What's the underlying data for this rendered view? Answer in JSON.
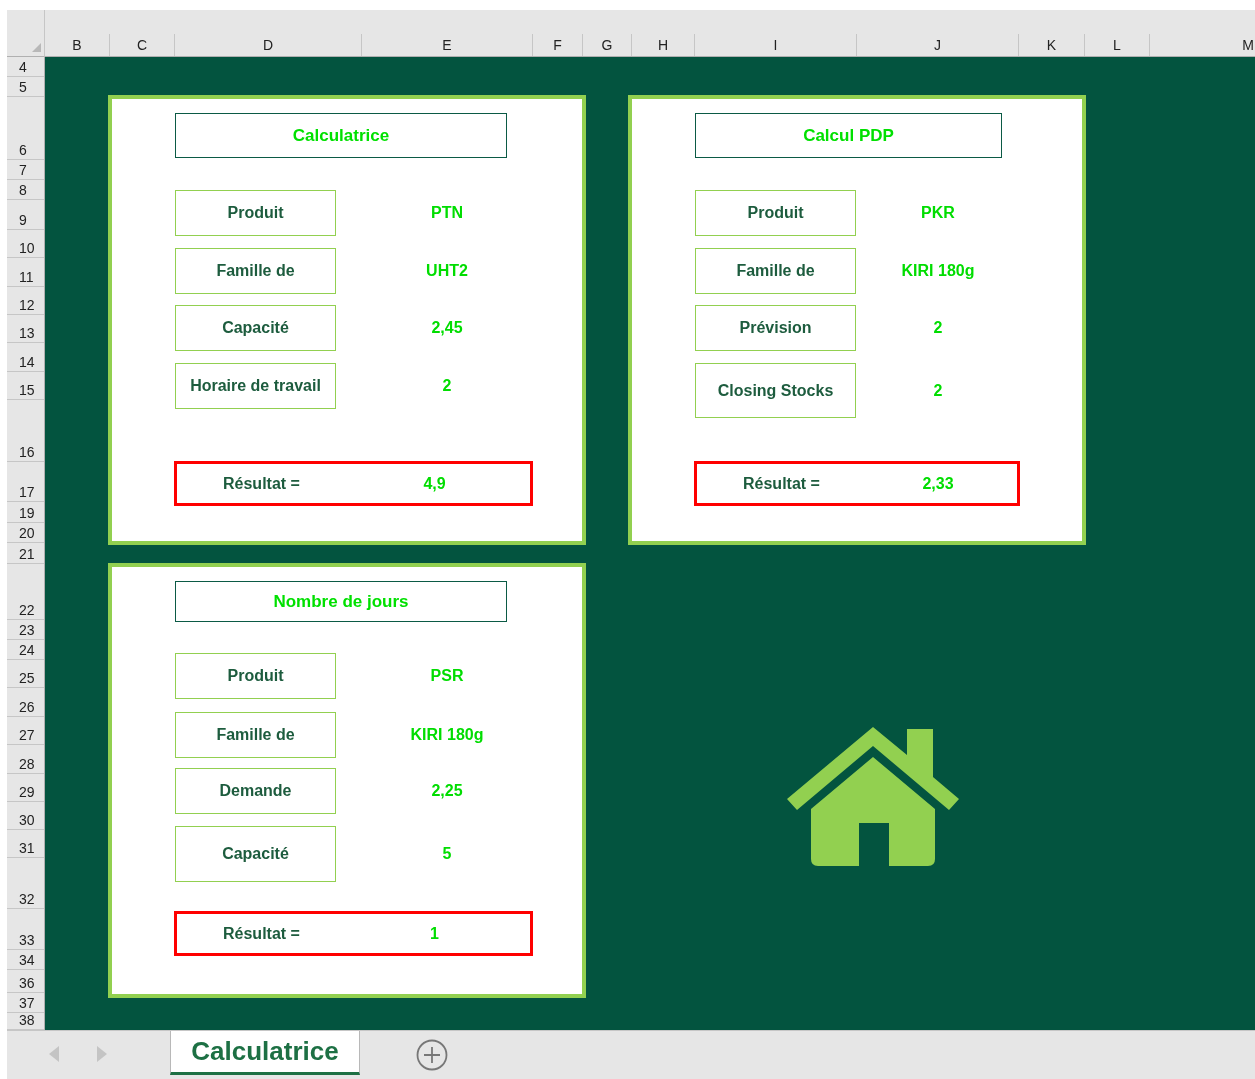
{
  "column_headers": [
    "B",
    "C",
    "D",
    "E",
    "F",
    "G",
    "H",
    "I",
    "J",
    "K",
    "L",
    "M"
  ],
  "row_headers": [
    "4",
    "5",
    "6",
    "7",
    "8",
    "9",
    "10",
    "11",
    "12",
    "13",
    "14",
    "15",
    "16",
    "17",
    "19",
    "20",
    "21",
    "22",
    "23",
    "24",
    "25",
    "26",
    "27",
    "28",
    "29",
    "30",
    "31",
    "32",
    "33",
    "34",
    "36",
    "37",
    "38"
  ],
  "cards": [
    {
      "title": "Calculatrice",
      "fields": [
        {
          "label": "Produit",
          "value": "PTN"
        },
        {
          "label": "Famille de",
          "value": "UHT2"
        },
        {
          "label": "Capacité",
          "value": "2,45"
        },
        {
          "label": "Horaire de travail",
          "value": "2"
        }
      ],
      "result": {
        "label": "Résultat =",
        "value": "4,9"
      }
    },
    {
      "title": "Calcul PDP",
      "fields": [
        {
          "label": "Produit",
          "value": "PKR"
        },
        {
          "label": "Famille de",
          "value": "KIRI 180g"
        },
        {
          "label": "Prévision",
          "value": "2"
        },
        {
          "label": "Closing Stocks",
          "value": "2"
        }
      ],
      "result": {
        "label": "Résultat =",
        "value": "2,33"
      }
    },
    {
      "title": "Nombre de jours",
      "fields": [
        {
          "label": "Produit",
          "value": "PSR"
        },
        {
          "label": "Famille de",
          "value": "KIRI 180g"
        },
        {
          "label": "Demande",
          "value": "2,25"
        },
        {
          "label": "Capacité",
          "value": "5"
        }
      ],
      "result": {
        "label": "Résultat =",
        "value": "1"
      }
    }
  ],
  "sheet_tabs": [
    {
      "label": "Calculatrice",
      "selected": true
    }
  ]
}
